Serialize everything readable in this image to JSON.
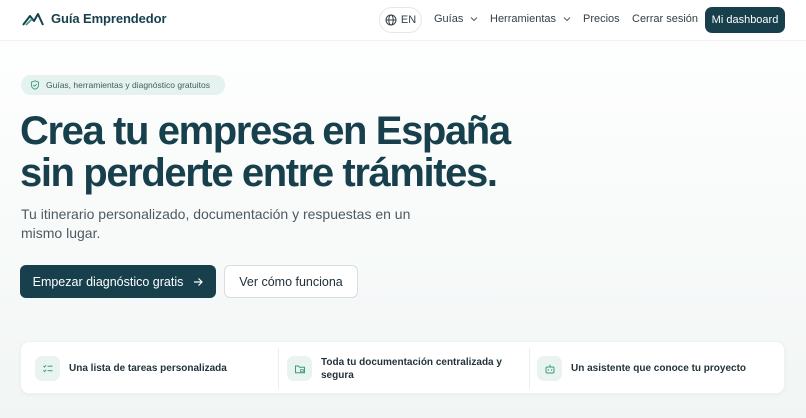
{
  "header": {
    "brand": "Guía Emprendedor",
    "language": "EN",
    "nav": {
      "guides": "Guías",
      "tools": "Herramientas",
      "pricing": "Precios",
      "logout": "Cerrar sesión"
    },
    "dashboard_button": "Mi dashboard"
  },
  "hero": {
    "badge": "Guías, herramientas y diagnóstico gratuitos",
    "headline_line1": "Crea tu empresa en España",
    "headline_line2": "sin perderte entre trámites.",
    "subtitle": "Tu itinerario personalizado, documentación y respuestas en un mismo lugar.",
    "primary_cta": "Empezar diagnóstico gratis",
    "secondary_cta": "Ver cómo funciona"
  },
  "features": [
    {
      "text": "Una lista de tareas personalizada",
      "icon": "checklist-icon"
    },
    {
      "text": "Toda tu documentación centralizada y segura",
      "icon": "folder-icon"
    },
    {
      "text": "Un asistente que conoce tu proyecto",
      "icon": "robot-icon"
    }
  ],
  "colors": {
    "brand": "#173f4c",
    "badge_bg": "#e6f2ef",
    "icon_bg": "#e9f3f0",
    "accent_green": "#3b9a82"
  }
}
